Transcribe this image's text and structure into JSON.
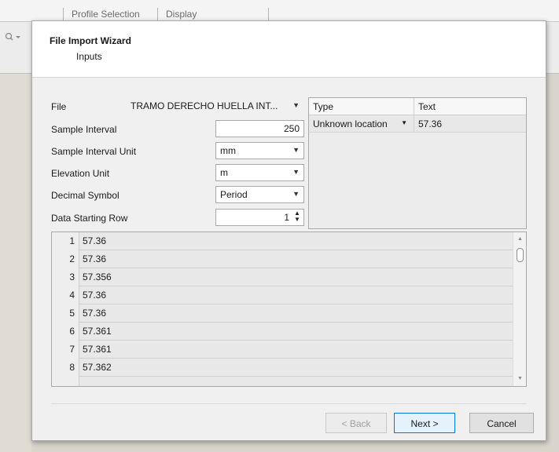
{
  "background": {
    "tabs": [
      "Profile Selection",
      "Display"
    ],
    "zoom_icon": "magnifier-dropdown-icon"
  },
  "dialog": {
    "title": "File Import Wizard",
    "subtitle": "Inputs"
  },
  "form": {
    "file_label": "File",
    "file_value": "TRAMO DERECHO HUELLA INT...",
    "sample_interval_label": "Sample Interval",
    "sample_interval_value": "250",
    "sample_interval_unit_label": "Sample Interval Unit",
    "sample_interval_unit_value": "mm",
    "elevation_unit_label": "Elevation Unit",
    "elevation_unit_value": "m",
    "decimal_symbol_label": "Decimal Symbol",
    "decimal_symbol_value": "Period",
    "data_starting_row_label": "Data Starting Row",
    "data_starting_row_value": "1"
  },
  "type_grid": {
    "headers": [
      "Type",
      "Text"
    ],
    "rows": [
      {
        "type": "Unknown location",
        "text": "57.36"
      }
    ]
  },
  "data_rows": [
    {
      "num": "1",
      "value": "57.36"
    },
    {
      "num": "2",
      "value": "57.36"
    },
    {
      "num": "3",
      "value": "57.356"
    },
    {
      "num": "4",
      "value": "57.36"
    },
    {
      "num": "5",
      "value": "57.36"
    },
    {
      "num": "6",
      "value": "57.361"
    },
    {
      "num": "7",
      "value": "57.361"
    },
    {
      "num": "8",
      "value": "57.362"
    }
  ],
  "buttons": {
    "back": "< Back",
    "next": "Next >",
    "cancel": "Cancel"
  }
}
